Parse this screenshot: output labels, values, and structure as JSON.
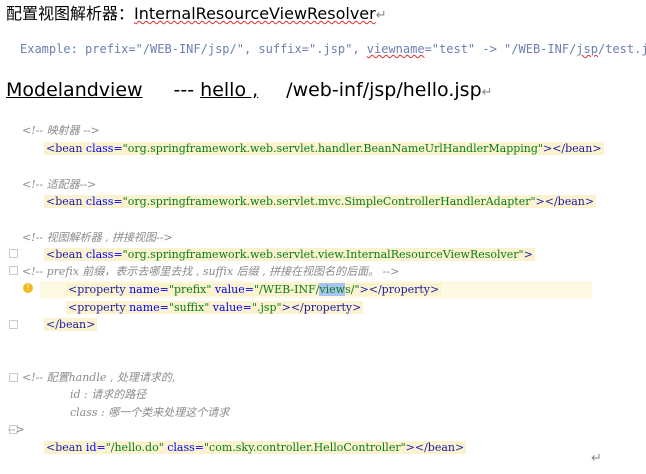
{
  "heading": {
    "prefix": "配置视图解析器：",
    "class_name": "InternalResourceViewResolver",
    "mark": "↵"
  },
  "example": {
    "text_a": "Example: prefix=\"/WEB-INF/jsp/\", suffix=\".jsp\", ",
    "viewname": "viewname",
    "text_b": "=\"test\" -> \"/WEB-INF/",
    "jsp": "jsp",
    "text_c": "/test.jsp\""
  },
  "mv": {
    "model": "Modelandview",
    "dashes": "---",
    "hello": "hello ,",
    "path": "/web-inf/jsp/hello.jsp",
    "mark": "↵"
  },
  "code": {
    "c1": "<!--  映射器  -->",
    "l1_open": "<bean ",
    "l1_attr": "class=",
    "l1_val": "\"org.springframework.web.servlet.handler.BeanNameUrlHandlerMapping\"",
    "l1_close": "></bean>",
    "c2": "<!--    适配器-->",
    "l2_open": "<bean ",
    "l2_attr": "class=",
    "l2_val": "\"org.springframework.web.servlet.mvc.SimpleControllerHandlerAdapter\"",
    "l2_close": "></bean>",
    "c3": "<!--    视图解析器 ,  拼接视图-->",
    "l3_open": "<bean ",
    "l3_attr": "class=",
    "l3_val": "\"org.springframework.web.servlet.view.InternalResourceViewResolver\"",
    "l3_close": ">",
    "c4": "<!--         prefix 前缀，表示去哪里去找 ,   suffix 后缀 ,   拼接在视图名的后面。 -->",
    "p1_open": "<property ",
    "p1_name_attr": "name=",
    "p1_name_val": "\"prefix\"",
    "p1_value_attr": " value=",
    "p1_value_a": "\"/WEB-INF/",
    "p1_value_sel": "view",
    "p1_value_b": "s/\"",
    "p1_close": "></property>",
    "p2_open": "<property ",
    "p2_name_attr": "name=",
    "p2_name_val": "\"suffix\"",
    "p2_value_attr": " value=",
    "p2_value_val": "\".jsp\"",
    "p2_close": "></property>",
    "bean_close": "</bean>",
    "c5a": "<!--    配置handle , 处理请求的,",
    "c5b": "id :  请求的路径",
    "c5c": "class : 哪一个类来处理这个请求",
    "c5d": "-->",
    "l5_open": "<bean ",
    "l5_id_attr": "id=",
    "l5_id_val": "\"/hello.do\"",
    "l5_attr": " class=",
    "l5_val": "\"com.sky.controller.HelloController\"",
    "l5_close": "></bean>"
  },
  "end_mark": "↵",
  "bulb_icon": "lightbulb-icon"
}
